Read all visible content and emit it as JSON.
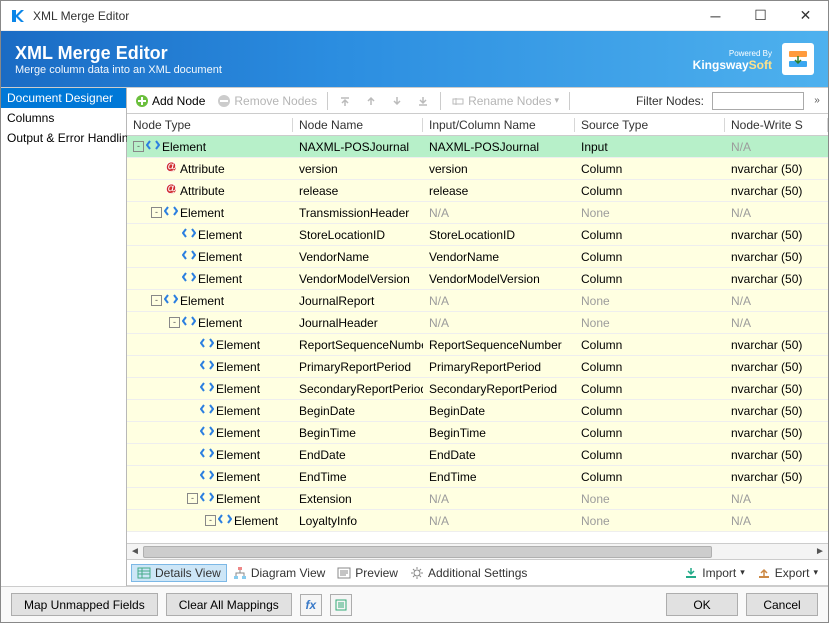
{
  "window": {
    "title": "XML Merge Editor"
  },
  "banner": {
    "title": "XML Merge Editor",
    "subtitle": "Merge column data into an XML document",
    "powered": "Powered By",
    "brand_part1": "Kingsway",
    "brand_part2": "Soft"
  },
  "left_nav": {
    "items": [
      {
        "label": "Document Designer",
        "selected": true
      },
      {
        "label": "Columns",
        "selected": false
      },
      {
        "label": "Output & Error Handling",
        "selected": false
      }
    ]
  },
  "toolbar": {
    "add_node": "Add Node",
    "remove_nodes": "Remove Nodes",
    "rename_nodes": "Rename Nodes",
    "filter_label": "Filter Nodes:",
    "filter_value": ""
  },
  "grid": {
    "columns": [
      "Node Type",
      "Node Name",
      "Input/Column Name",
      "Source Type",
      "Node-Write S"
    ],
    "rows": [
      {
        "depth": 0,
        "toggle": "-",
        "icon": "element",
        "type": "Element",
        "name": "NAXML-POSJournal",
        "col": "NAXML-POSJournal",
        "source": "Input",
        "write": "N/A",
        "selected": true
      },
      {
        "depth": 1,
        "toggle": "",
        "icon": "attribute",
        "type": "Attribute",
        "name": "version",
        "col": "version",
        "source": "Column",
        "write": "nvarchar (50)"
      },
      {
        "depth": 1,
        "toggle": "",
        "icon": "attribute",
        "type": "Attribute",
        "name": "release",
        "col": "release",
        "source": "Column",
        "write": "nvarchar (50)"
      },
      {
        "depth": 1,
        "toggle": "-",
        "icon": "element",
        "type": "Element",
        "name": "TransmissionHeader",
        "col": "N/A",
        "source": "None",
        "write": "N/A"
      },
      {
        "depth": 2,
        "toggle": "",
        "icon": "element",
        "type": "Element",
        "name": "StoreLocationID",
        "col": "StoreLocationID",
        "source": "Column",
        "write": "nvarchar (50)"
      },
      {
        "depth": 2,
        "toggle": "",
        "icon": "element",
        "type": "Element",
        "name": "VendorName",
        "col": "VendorName",
        "source": "Column",
        "write": "nvarchar (50)"
      },
      {
        "depth": 2,
        "toggle": "",
        "icon": "element",
        "type": "Element",
        "name": "VendorModelVersion",
        "col": "VendorModelVersion",
        "source": "Column",
        "write": "nvarchar (50)"
      },
      {
        "depth": 1,
        "toggle": "-",
        "icon": "element",
        "type": "Element",
        "name": "JournalReport",
        "col": "N/A",
        "source": "None",
        "write": "N/A"
      },
      {
        "depth": 2,
        "toggle": "-",
        "icon": "element",
        "type": "Element",
        "name": "JournalHeader",
        "col": "N/A",
        "source": "None",
        "write": "N/A"
      },
      {
        "depth": 3,
        "toggle": "",
        "icon": "element",
        "type": "Element",
        "name": "ReportSequenceNumber",
        "col": "ReportSequenceNumber",
        "source": "Column",
        "write": "nvarchar (50)"
      },
      {
        "depth": 3,
        "toggle": "",
        "icon": "element",
        "type": "Element",
        "name": "PrimaryReportPeriod",
        "col": "PrimaryReportPeriod",
        "source": "Column",
        "write": "nvarchar (50)"
      },
      {
        "depth": 3,
        "toggle": "",
        "icon": "element",
        "type": "Element",
        "name": "SecondaryReportPeriod",
        "col": "SecondaryReportPeriod",
        "source": "Column",
        "write": "nvarchar (50)"
      },
      {
        "depth": 3,
        "toggle": "",
        "icon": "element",
        "type": "Element",
        "name": "BeginDate",
        "col": "BeginDate",
        "source": "Column",
        "write": "nvarchar (50)"
      },
      {
        "depth": 3,
        "toggle": "",
        "icon": "element",
        "type": "Element",
        "name": "BeginTime",
        "col": "BeginTime",
        "source": "Column",
        "write": "nvarchar (50)"
      },
      {
        "depth": 3,
        "toggle": "",
        "icon": "element",
        "type": "Element",
        "name": "EndDate",
        "col": "EndDate",
        "source": "Column",
        "write": "nvarchar (50)"
      },
      {
        "depth": 3,
        "toggle": "",
        "icon": "element",
        "type": "Element",
        "name": "EndTime",
        "col": "EndTime",
        "source": "Column",
        "write": "nvarchar (50)"
      },
      {
        "depth": 3,
        "toggle": "-",
        "icon": "element",
        "type": "Element",
        "name": "Extension",
        "col": "N/A",
        "source": "None",
        "write": "N/A"
      },
      {
        "depth": 4,
        "toggle": "-",
        "icon": "element",
        "type": "Element",
        "name": "LoyaltyInfo",
        "col": "N/A",
        "source": "None",
        "write": "N/A"
      }
    ]
  },
  "viewbar": {
    "details": "Details View",
    "diagram": "Diagram View",
    "preview": "Preview",
    "additional": "Additional Settings",
    "import": "Import",
    "export": "Export"
  },
  "footer": {
    "map": "Map Unmapped Fields",
    "clear": "Clear All Mappings",
    "ok": "OK",
    "cancel": "Cancel"
  }
}
